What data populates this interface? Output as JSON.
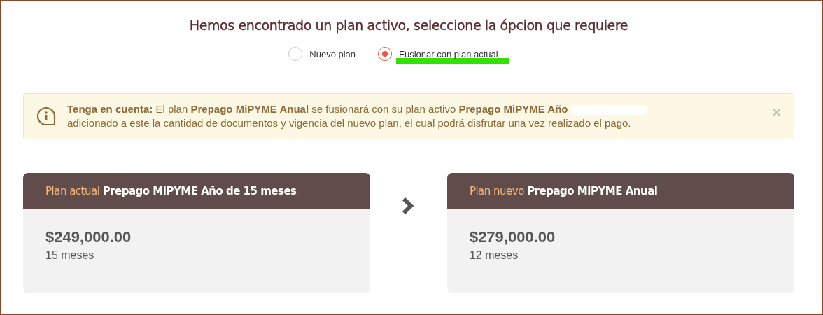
{
  "heading": "Hemos encontrado un plan activo, seleccione la ópcion que requiere",
  "options": [
    {
      "label": "Nuevo plan",
      "selected": false,
      "highlighted": false
    },
    {
      "label": "Fusionar con plan actual",
      "selected": true,
      "highlighted": true
    }
  ],
  "notice": {
    "text": "**Tenga en cuenta:** El plan **Prepago MiPYME Anual** se fusionará con su plan activo **Prepago MiPYME Año**",
    "continuation": "adicionado a este la cantidad de documentos y vigencia del nuevo plan, el cual podrá disfrutar una vez realizado el pago.",
    "redacted": true,
    "close": "×"
  },
  "plans": [
    {
      "label": "Plan actual",
      "name": "Prepago MiPYME Año de 15 meses",
      "price": "$249,000.00",
      "duration": "15 meses"
    },
    {
      "label": "Plan nuevo",
      "name": "Prepago MiPYME Anual",
      "price": "$279,000.00",
      "duration": "12 meses"
    }
  ]
}
